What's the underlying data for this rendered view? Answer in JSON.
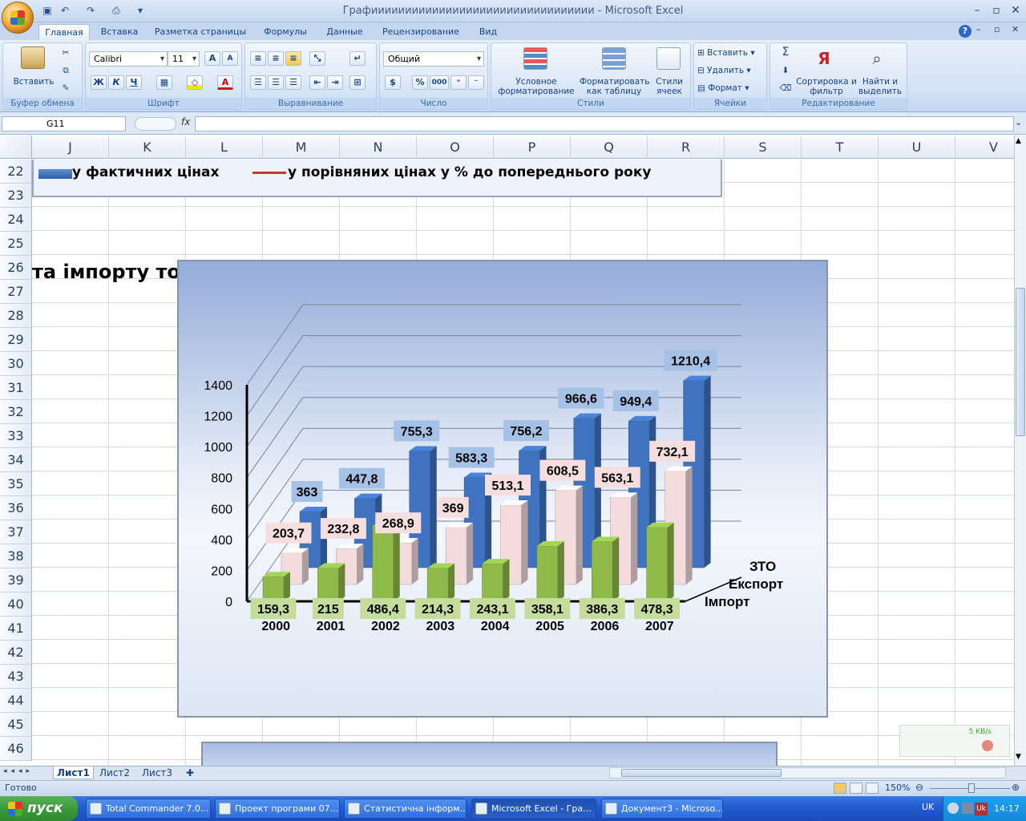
{
  "window": {
    "title": "Графиииииииииииииииииииииииииииииииии - Microsoft Excel",
    "min": "–",
    "max": "▫",
    "close": "✕",
    "help": "?"
  },
  "tabs": [
    "Главная",
    "Вставка",
    "Разметка страницы",
    "Формулы",
    "Данные",
    "Рецензирование",
    "Вид"
  ],
  "ribbon": {
    "clipboard": {
      "label": "Буфер обмена",
      "paste": "Вставить"
    },
    "font": {
      "label": "Шрифт",
      "name": "Calibri",
      "size": "11",
      "bold": "Ж",
      "italic": "К",
      "underline": "Ч",
      "grow": "A",
      "shrink": "A"
    },
    "alignment": {
      "label": "Выравнивание"
    },
    "number": {
      "label": "Число",
      "format": "Общий",
      "percent": "%",
      "thousands": "000"
    },
    "styles": {
      "label": "Стили",
      "conditional": "Условное форматирование",
      "as_table": "Форматировать как таблицу",
      "cell_styles": "Стили ячеек"
    },
    "cells": {
      "label": "Ячейки",
      "insert": "Вставить",
      "delete": "Удалить",
      "format": "Формат"
    },
    "editing": {
      "label": "Редактирование",
      "sum": "Σ",
      "sort": "Сортировка и фильтр",
      "find": "Найти и выделить"
    }
  },
  "formula_bar": {
    "name_box": "G11",
    "fx": "fx",
    "value": ""
  },
  "columns": [
    "J",
    "K",
    "L",
    "M",
    "N",
    "O",
    "P",
    "Q",
    "R",
    "S",
    "T",
    "U",
    "V"
  ],
  "rows": [
    "22",
    "23",
    "24",
    "25",
    "26",
    "27",
    "28",
    "29",
    "30",
    "31",
    "32",
    "33",
    "34",
    "35",
    "36",
    "37",
    "38",
    "39",
    "40",
    "41",
    "42",
    "43",
    "44",
    "45",
    "46"
  ],
  "legend": {
    "series1": "у фактичних цінах",
    "series2": "у порівняних цінах у % до попереднього року"
  },
  "sheet_heading": "та імпорту тов",
  "chart_data": {
    "type": "bar",
    "variant": "3d-clustered-depth",
    "categories": [
      "2000",
      "2001",
      "2002",
      "2003",
      "2004",
      "2005",
      "2006",
      "2007"
    ],
    "ylim": [
      0,
      1400
    ],
    "yticks": [
      0,
      200,
      400,
      600,
      800,
      1000,
      1200,
      1400
    ],
    "series": [
      {
        "name": "ЗТО",
        "color": "#3f73bf",
        "values": [
          363,
          447.8,
          755.3,
          583.3,
          756.2,
          966.6,
          949.4,
          1210.4
        ],
        "labels": [
          "363",
          "447,8",
          "755,3",
          "583,3",
          "756,2",
          "966,6",
          "949,4",
          "1210,4"
        ]
      },
      {
        "name": "Експорт",
        "color": "#f4dcdc",
        "values": [
          203.7,
          232.8,
          268.9,
          369,
          513.1,
          608.5,
          563.1,
          732.1
        ],
        "labels": [
          "203,7",
          "232,8",
          "268,9",
          "369",
          "513,1",
          "608,5",
          "563,1",
          "732,1"
        ]
      },
      {
        "name": "Імпорт",
        "color": "#8fba4a",
        "values": [
          159.3,
          215,
          486.4,
          214.3,
          243.1,
          358.1,
          386.3,
          478.3
        ],
        "labels": [
          "159,3",
          "215",
          "486,4",
          "214,3",
          "243,1",
          "358,1",
          "386,3",
          "478,3"
        ]
      }
    ],
    "grid": true
  },
  "sheets": [
    "Лист1",
    "Лист2",
    "Лист3"
  ],
  "status": {
    "ready": "Готово",
    "zoom": "150%"
  },
  "network": {
    "speed": "5 KB/s"
  },
  "taskbar": {
    "start": "пуск",
    "tasks": [
      "Total Commander 7.0...",
      "Проект програми 07...",
      "Статистична інформ...",
      "Microsoft Excel - Гра...",
      "Документ3 - Microso..."
    ],
    "lang": "UK",
    "clock": "14:17"
  }
}
